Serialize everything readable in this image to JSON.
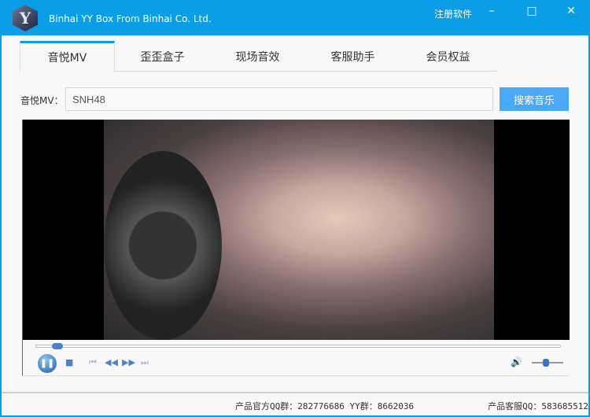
{
  "window": {
    "title": "Binhai YY Box From Binhai Co. Ltd.",
    "logo_letter": "Y",
    "register": "注册软件"
  },
  "tabs": [
    "音悦MV",
    "歪歪盒子",
    "现场音效",
    "客服助手",
    "会员权益"
  ],
  "search": {
    "label": "音悦MV：",
    "value": "SNH48",
    "button": "搜索音乐"
  },
  "player": {
    "progress": 0.03,
    "volume": 0.45
  },
  "footer": {
    "qq_group": "产品官方QQ群：282776686  YY群：8662036",
    "service": "产品客服QQ：583685512"
  }
}
